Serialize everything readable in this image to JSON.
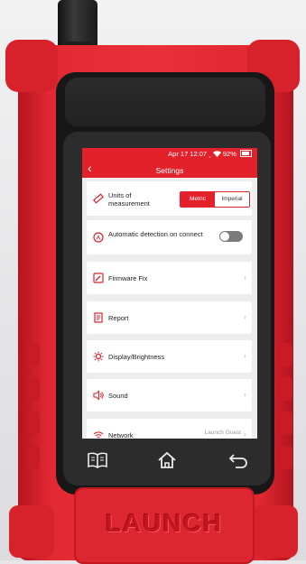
{
  "status_bar": {
    "datetime": "Apr 17 12:07",
    "battery": "92%",
    "wifi_icon": "wifi-icon"
  },
  "header": {
    "back_symbol": "‹",
    "title": "Settings"
  },
  "settings": {
    "units": {
      "label": "Units of measurement",
      "metric": "Metric",
      "imperial": "Imperial",
      "selected": "Metric"
    },
    "auto_detect": {
      "label": "Automatic detection on connect",
      "enabled": false
    },
    "firmware": {
      "label": "Firmware Fix"
    },
    "report": {
      "label": "Report"
    },
    "display": {
      "label": "Display/Brightness"
    },
    "sound": {
      "label": "Sound"
    },
    "network": {
      "label": "Network",
      "value": "Launch Guest"
    }
  },
  "hardware_keys": {
    "book": "book-icon",
    "home": "home-icon",
    "back": "return-icon"
  },
  "device": {
    "brand": "LAUNCH",
    "case_color": "#e32a33",
    "accent": "#e3212a"
  }
}
